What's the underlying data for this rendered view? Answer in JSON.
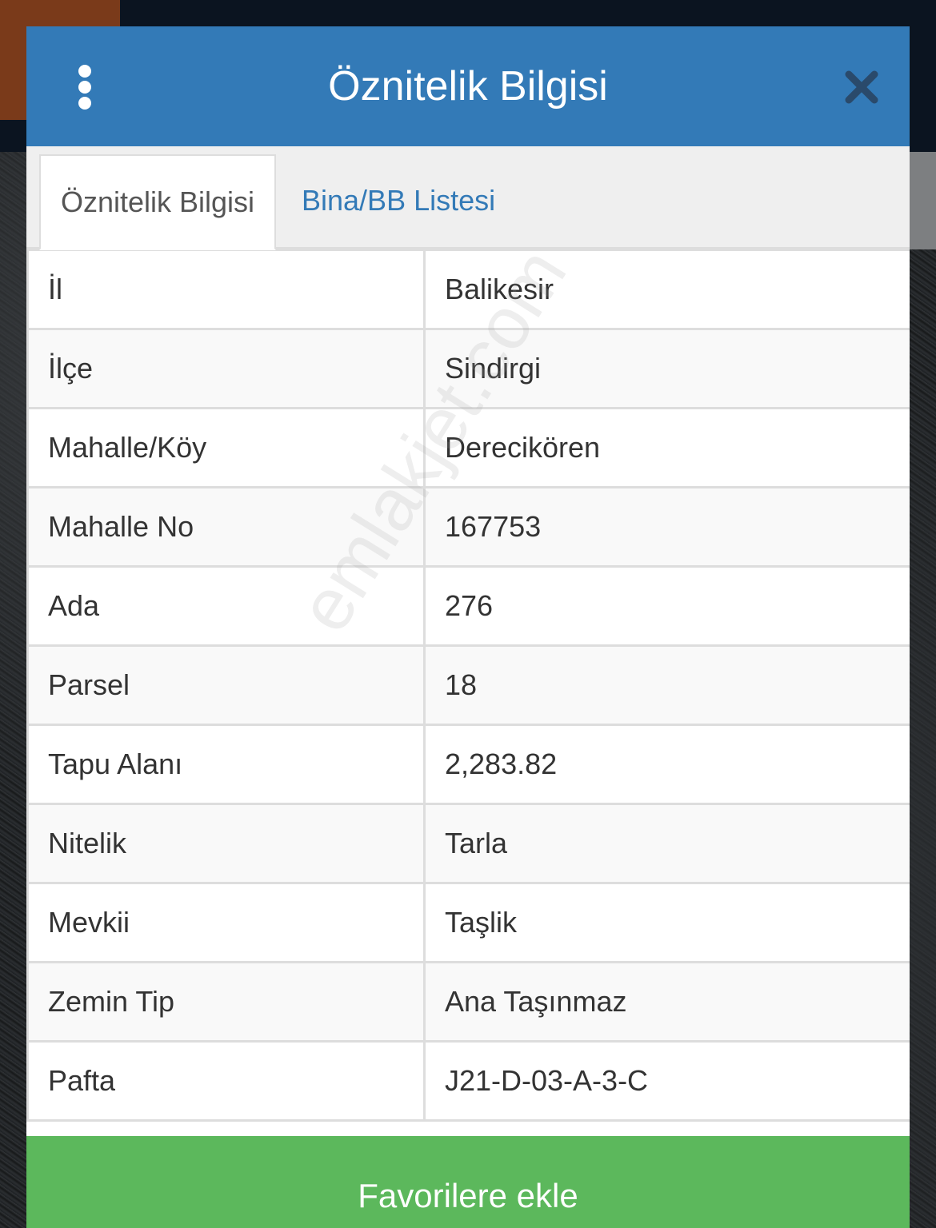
{
  "modal": {
    "title": "Öznitelik Bilgisi",
    "tabs": [
      {
        "label": "Öznitelik Bilgisi",
        "active": true
      },
      {
        "label": "Bina/BB Listesi",
        "active": false
      }
    ],
    "rows": [
      {
        "label": "İl",
        "value": "Balikesir"
      },
      {
        "label": "İlçe",
        "value": "Sindirgi"
      },
      {
        "label": "Mahalle/Köy",
        "value": "Derecikören"
      },
      {
        "label": "Mahalle No",
        "value": "167753"
      },
      {
        "label": "Ada",
        "value": "276"
      },
      {
        "label": "Parsel",
        "value": "18"
      },
      {
        "label": "Tapu Alanı",
        "value": "2,283.82"
      },
      {
        "label": "Nitelik",
        "value": "Tarla"
      },
      {
        "label": "Mevkii",
        "value": "Taşlik"
      },
      {
        "label": "Zemin Tip",
        "value": "Ana Taşınmaz"
      },
      {
        "label": "Pafta",
        "value": "J21-D-03-A-3-C"
      }
    ],
    "favorite_button_label": "Favorilere ekle"
  },
  "watermark": "emlakjet.com",
  "icons": {
    "menu": "vertical-dots-icon",
    "close": "close-icon"
  },
  "colors": {
    "header": "#337ab7",
    "button": "#5cb85c",
    "tab_link": "#337ab7"
  }
}
